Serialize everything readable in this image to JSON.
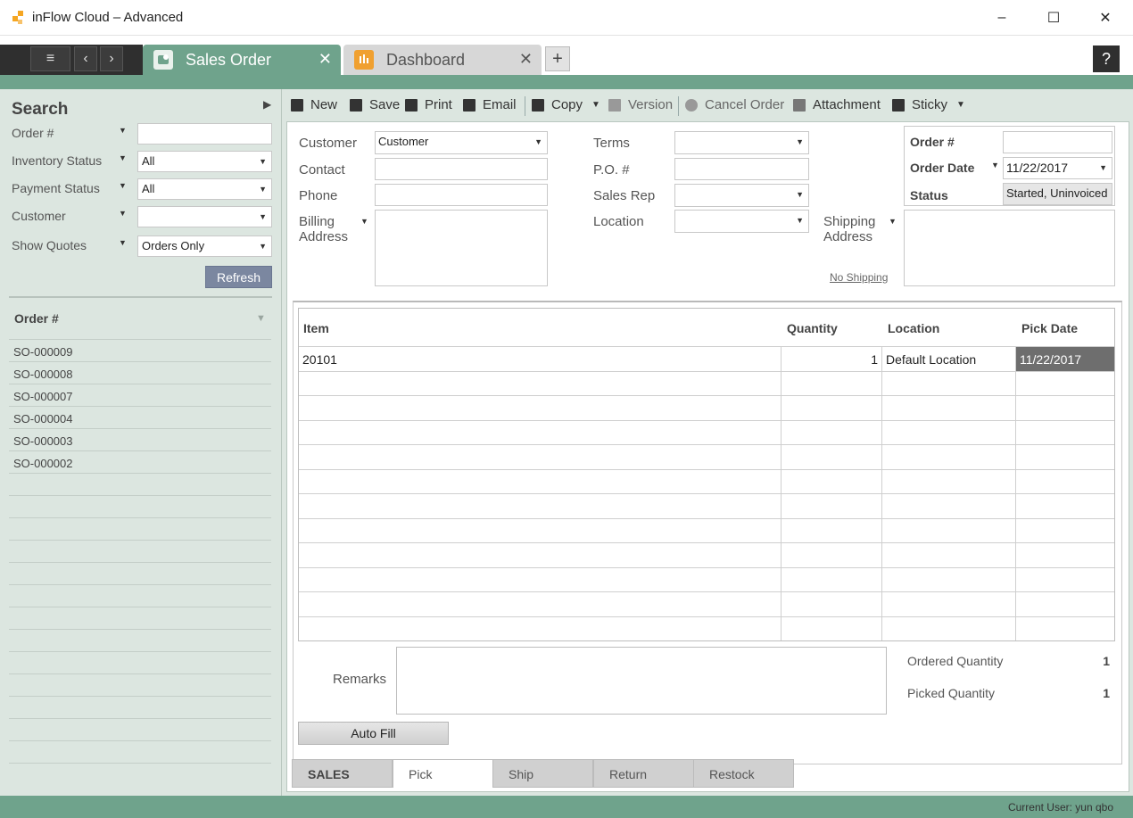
{
  "window": {
    "title": "inFlow Cloud – Advanced",
    "minimize": "–",
    "maximize": "☐",
    "close": "✕"
  },
  "tabs": [
    {
      "label": "Sales Order",
      "close": "✕",
      "icon": "sales-order-icon"
    },
    {
      "label": "Dashboard",
      "close": "✕",
      "icon": "dashboard-icon"
    }
  ],
  "tabstrip": {
    "menu": "≡",
    "back": "‹",
    "forward": "›",
    "add": "+",
    "help": "?"
  },
  "search": {
    "title": "Search",
    "fields": [
      {
        "label": "Order #",
        "value": ""
      },
      {
        "label": "Inventory Status",
        "value": "All"
      },
      {
        "label": "Payment Status",
        "value": "All"
      },
      {
        "label": "Customer",
        "value": ""
      },
      {
        "label": "Show Quotes",
        "value": "Orders Only"
      }
    ],
    "refresh": "Refresh"
  },
  "order_list": {
    "header": "Order #",
    "items": [
      "SO-000009",
      "SO-000008",
      "SO-000007",
      "SO-000004",
      "SO-000003",
      "SO-000002"
    ]
  },
  "toolbar": {
    "new": "New",
    "save": "Save",
    "print": "Print",
    "email": "Email",
    "copy": "Copy",
    "version": "Version",
    "cancel_order": "Cancel Order",
    "attachment": "Attachment",
    "sticky": "Sticky"
  },
  "form": {
    "customer_label": "Customer",
    "customer_value": "Customer",
    "contact_label": "Contact",
    "phone_label": "Phone",
    "billing_label_1": "Billing",
    "billing_label_2": "Address",
    "terms_label": "Terms",
    "po_label": "P.O. #",
    "sales_rep_label": "Sales Rep",
    "location_label": "Location",
    "shipping_label_1": "Shipping",
    "shipping_label_2": "Address",
    "no_shipping": "No Shipping",
    "order_no_label": "Order #",
    "order_no_value": "",
    "order_date_label": "Order Date",
    "order_date_value": "11/22/2017",
    "status_label": "Status",
    "status_value": "Started, Uninvoiced"
  },
  "grid": {
    "headers": {
      "item": "Item",
      "quantity": "Quantity",
      "location": "Location",
      "pick_date": "Pick Date"
    },
    "rows": [
      {
        "item": "20101",
        "quantity": "1",
        "location": "Default Location",
        "pick_date": "11/22/2017"
      }
    ]
  },
  "footer": {
    "remarks_label": "Remarks",
    "ordered_qty_label": "Ordered Quantity",
    "ordered_qty_value": "1",
    "picked_qty_label": "Picked Quantity",
    "picked_qty_value": "1",
    "autofill": "Auto Fill"
  },
  "bottom_tabs": [
    "SALES",
    "Pick",
    "Ship",
    "Return",
    "Restock"
  ],
  "status_bar": {
    "current_user": "Current User:  yun qbo"
  },
  "colors": {
    "accent_green": "#6fa38c",
    "panel_bg": "#dce6e0",
    "refresh_btn": "#7b87a0",
    "selected_cell": "#6e6e6e"
  }
}
